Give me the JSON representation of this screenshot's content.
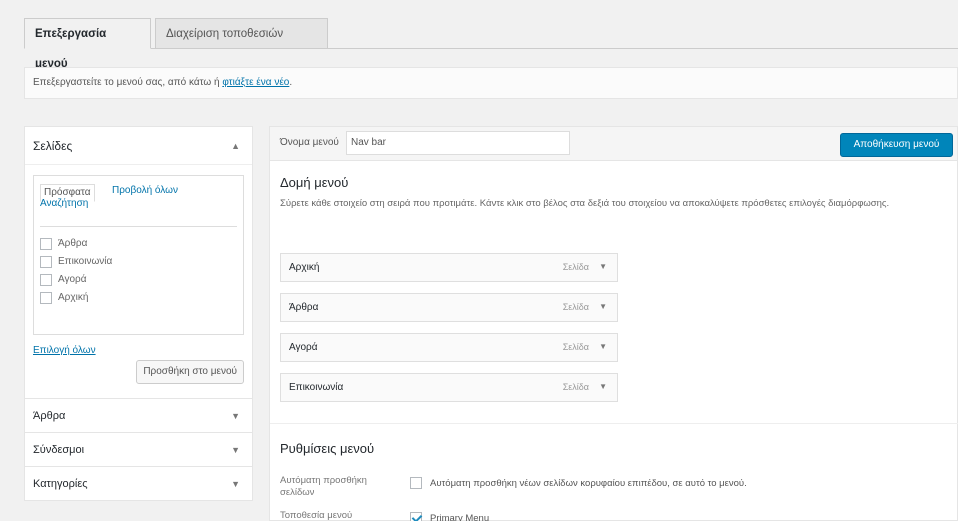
{
  "tabs": [
    {
      "label": "Επεξεργασία μενού",
      "active": true
    },
    {
      "label": "Διαχείριση τοποθεσιών",
      "active": false
    }
  ],
  "manage": {
    "text": "Επεξεργαστείτε το μενού σας, από κάτω ή ",
    "link": "φτιάξτε ένα νέο"
  },
  "pages_box": {
    "title": "Σελίδες",
    "tab_recent": "Πρόσφατα",
    "tab_all": "Προβολή όλων",
    "tab_search": "Αναζήτηση",
    "items": [
      "Άρθρα",
      "Επικοινωνία",
      "Αγορά",
      "Αρχική"
    ],
    "select_all": "Επιλογή όλων",
    "add_button": "Προσθήκη στο μενού"
  },
  "accordions": [
    "Άρθρα",
    "Σύνδεσμοι",
    "Κατηγορίες"
  ],
  "menu_name": {
    "label": "Όνομα μενού",
    "value": "Nav bar"
  },
  "save_button": "Αποθήκευση μενού",
  "structure": {
    "title": "Δομή μενού",
    "description": "Σύρετε κάθε στοιχείο στη σειρά που προτιμάτε. Κάντε κλικ στο βέλος στα δεξιά του στοιχείου να αποκαλύψετε πρόσθετες επιλογές διαμόρφωσης."
  },
  "menu_items": [
    {
      "label": "Αρχική",
      "type": "Σελίδα"
    },
    {
      "label": "Άρθρα",
      "type": "Σελίδα"
    },
    {
      "label": "Αγορά",
      "type": "Σελίδα"
    },
    {
      "label": "Επικοινωνία",
      "type": "Σελίδα"
    }
  ],
  "settings": {
    "title": "Ρυθμίσεις μενού",
    "auto_add_label": "Αυτόματη προσθήκη σελίδων",
    "auto_add_value": "Αυτόματη προσθήκη νέων σελίδων κορυφαίου επιπέδου, σε αυτό το μενού.",
    "location_label": "Τοποθεσία μενού",
    "location_value": "Primary Menu"
  }
}
